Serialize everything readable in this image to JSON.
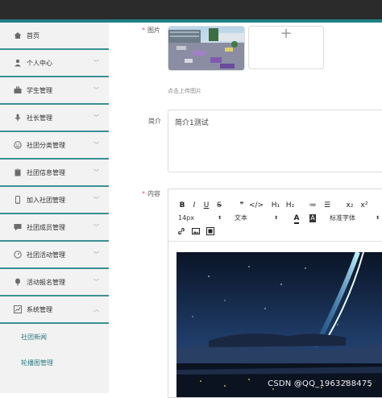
{
  "sidebar": {
    "items": [
      {
        "label": "首页",
        "icon": "home-icon",
        "has_chevron": false
      },
      {
        "label": "个人中心",
        "icon": "user-icon",
        "has_chevron": true
      },
      {
        "label": "学生管理",
        "icon": "briefcase-icon",
        "has_chevron": true
      },
      {
        "label": "社长管理",
        "icon": "microphone-icon",
        "has_chevron": true
      },
      {
        "label": "社团分类管理",
        "icon": "smiley-icon",
        "has_chevron": true
      },
      {
        "label": "社团信息管理",
        "icon": "clipboard-icon",
        "has_chevron": true
      },
      {
        "label": "加入社团管理",
        "icon": "phone-icon",
        "has_chevron": true
      },
      {
        "label": "社团成员管理",
        "icon": "chat-icon",
        "has_chevron": true
      },
      {
        "label": "社团活动管理",
        "icon": "dashboard-icon",
        "has_chevron": true
      },
      {
        "label": "活动报名管理",
        "icon": "balloon-icon",
        "has_chevron": true
      },
      {
        "label": "系统管理",
        "icon": "chart-icon",
        "has_chevron": true,
        "expanded": true
      }
    ],
    "subitems": [
      {
        "label": "社团新闻"
      },
      {
        "label": "轮播图管理"
      }
    ]
  },
  "form": {
    "image_label": "图片",
    "upload_tip": "点击上传图片",
    "upload_plus": "+",
    "intro_label": "简介",
    "intro_value": "简介1测试",
    "content_label": "内容",
    "required_mark": "*"
  },
  "editor": {
    "toolbar_row1": [
      "B",
      "I",
      "U",
      "S",
      "❞",
      "</>",
      "H₁",
      "H₂",
      "≔",
      "☰",
      "x₂",
      "x²"
    ],
    "font_size": "14px",
    "block_type": "文本",
    "font_family": "标准字体",
    "color_btn": "A",
    "bg_btn": "A",
    "toolbar_row3": [
      "link-icon",
      "image-icon",
      "video-icon"
    ]
  },
  "watermark": "CSDN @QQ_1963288475",
  "colors": {
    "accent": "#1f7f86",
    "topbar": "#2b2b2b",
    "menu_border": "#3a8f94",
    "required": "#e05757"
  }
}
